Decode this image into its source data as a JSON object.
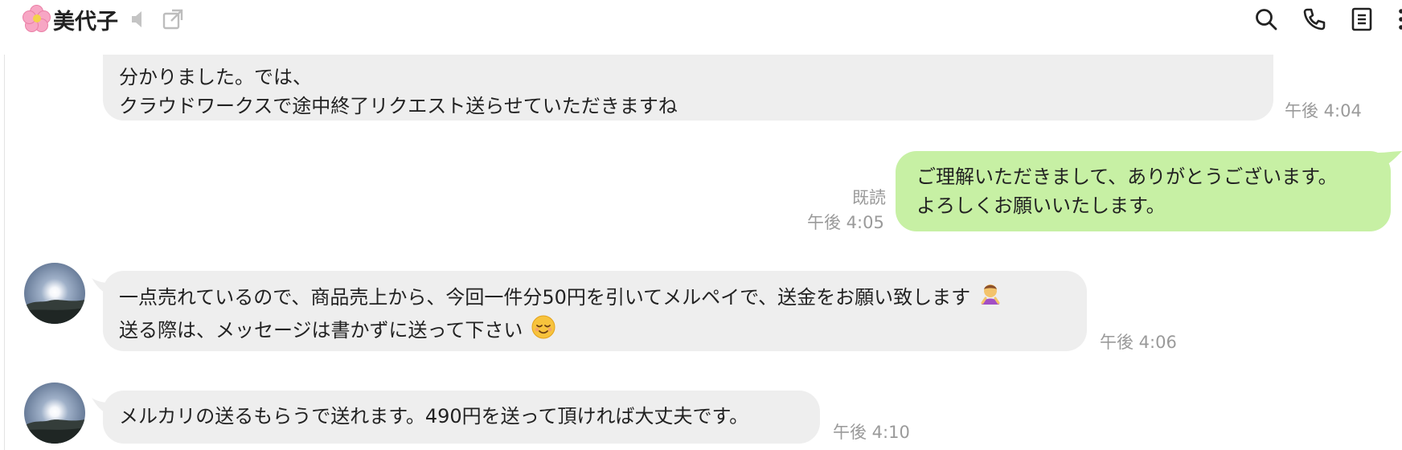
{
  "header": {
    "title": "美代子",
    "icons": [
      "cherry-blossom-icon",
      "mute-speaker-icon",
      "popout-icon",
      "search-icon",
      "phone-icon",
      "notes-icon",
      "more-icon"
    ]
  },
  "messages": [
    {
      "direction": "incoming",
      "lines": [
        "分かりました。では、",
        "クラウドワークスで途中終了リクエスト送らせていただきますね"
      ],
      "time": "午後 4:04"
    },
    {
      "direction": "outgoing",
      "lines": [
        "ご理解いただきまして、ありがとうございます。",
        "よろしくお願いいたします。"
      ],
      "read": "既読",
      "time": "午後 4:05"
    },
    {
      "direction": "incoming",
      "lines": [
        "一点売れているので、商品売上から、今回一件分50円を引いてメルペイで、送金をお願い致します",
        "送る際は、メッセージは書かずに送って下さい"
      ],
      "emojis": [
        "bowing-woman-emoji",
        "relieved-face-emoji"
      ],
      "time": "午後 4:06"
    },
    {
      "direction": "incoming",
      "lines": [
        "メルカリの送るもらうで送れます。490円を送って頂ければ大丈夫です。"
      ],
      "time": "午後 4:10"
    }
  ],
  "colors": {
    "incoming_bubble": "#eeeeee",
    "outgoing_bubble": "#c7f0a4",
    "timestamp": "#9a9a9a"
  }
}
